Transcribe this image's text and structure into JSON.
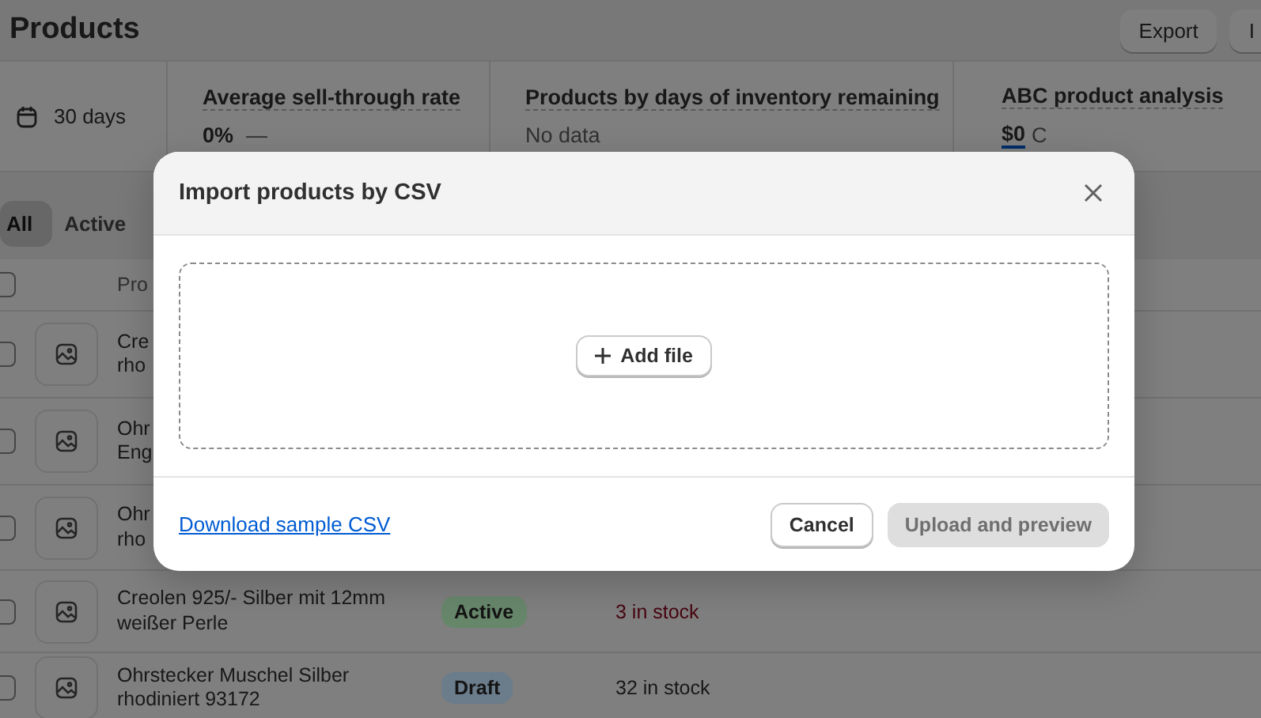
{
  "page": {
    "title": "Products",
    "actions": [
      {
        "label": "Export"
      },
      {
        "label": "I"
      }
    ]
  },
  "metrics": {
    "date_range": "30 days",
    "cards": [
      {
        "title": "Average sell-through rate",
        "value": "0%",
        "trend": "—"
      },
      {
        "title": "Products by days of inventory remaining",
        "value": "No data"
      },
      {
        "title": "ABC product analysis",
        "value": "$0",
        "extra": "C"
      }
    ]
  },
  "tabs": [
    {
      "label": "All",
      "selected": true
    },
    {
      "label": "Active",
      "selected": false
    }
  ],
  "table": {
    "select_all_checked": false,
    "columns": [
      "Pro"
    ],
    "rows": [
      {
        "checked": false,
        "name": [
          "Cre",
          "rho"
        ]
      },
      {
        "checked": false,
        "name": [
          "Ohr",
          "Eng"
        ]
      },
      {
        "checked": false,
        "name": [
          "Ohr",
          "rho"
        ]
      },
      {
        "checked": false,
        "name": [
          "Creolen 925/- Silber mit 12mm",
          "weißer Perle"
        ],
        "status": "Active",
        "color": "#67876b",
        "stock": "3 in stock",
        "low_stock": true
      },
      {
        "checked": false,
        "name": [
          "Ohrstecker Muschel Silber",
          "rhodiniert 93172"
        ],
        "status": "Draft",
        "color": "#6b7c8b",
        "stock": "32 in stock",
        "low_stock": false
      }
    ]
  },
  "dialog": {
    "title": "Import products by CSV",
    "add_file": "Add file",
    "link": "Download sample CSV",
    "buttons": [
      {
        "label": "Cancel",
        "kind": "secondary",
        "disabled": false
      },
      {
        "label": "Upload and preview",
        "kind": "primary",
        "disabled": true
      }
    ]
  }
}
